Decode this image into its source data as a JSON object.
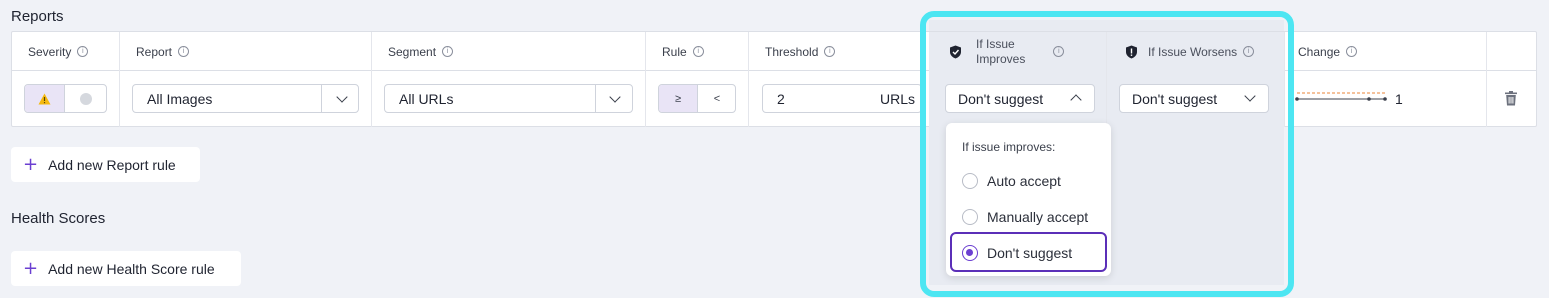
{
  "sections": {
    "reports_title": "Reports",
    "health_title": "Health Scores"
  },
  "table": {
    "headers": {
      "severity": "Severity",
      "report": "Report",
      "segment": "Segment",
      "rule": "Rule",
      "threshold": "Threshold",
      "improves_line1": "If Issue",
      "improves_line2": "Improves",
      "worsens": "If Issue Worsens",
      "change": "Change"
    },
    "row": {
      "report_value": "All Images",
      "segment_value": "All URLs",
      "rule_gte": "≥",
      "rule_lt": "<",
      "threshold_value": "2",
      "threshold_unit": "URLs",
      "improves_value": "Don't suggest",
      "worsens_value": "Don't suggest",
      "change_value": "1"
    }
  },
  "dropdown": {
    "heading": "If issue improves:",
    "options": [
      "Auto accept",
      "Manually accept",
      "Don't suggest"
    ],
    "selected": "Don't suggest"
  },
  "buttons": {
    "add_report_rule": "Add new Report rule",
    "add_health_rule": "Add new Health Score rule"
  },
  "icons": {
    "info": "info-icon",
    "warning": "warning-icon",
    "shield_check": "shield-check-icon",
    "shield_alert": "shield-alert-icon",
    "trash": "trash-icon",
    "chevron": "chevron-down-icon",
    "plus": "plus-icon"
  },
  "colors": {
    "accent": "#6b3fd1",
    "highlight": "#4de6f2",
    "warning": "#f5b90f"
  }
}
